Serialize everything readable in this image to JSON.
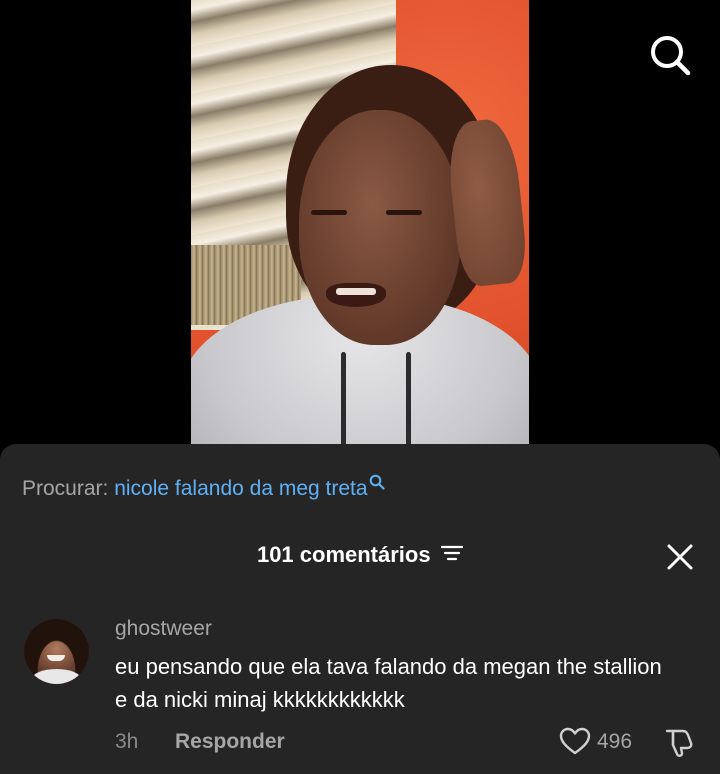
{
  "video": {
    "description_icons": [
      "search-icon"
    ]
  },
  "search_suggestion": {
    "label": "Procurar:",
    "query": "nicole falando da meg treta"
  },
  "comments_header": {
    "count_label": "101 comentários"
  },
  "comment": {
    "username": "ghostweer",
    "text": "eu pensando que ela tava falando da megan the stallion e da nicki minaj kkkkkkkkkkkk",
    "time": "3h",
    "reply_label": "Responder",
    "like_count": "496"
  },
  "colors": {
    "sheet_bg": "#252525",
    "link_blue": "#5fb0f5",
    "muted_text": "#a6a6a6",
    "primary_text": "#ffffff"
  }
}
